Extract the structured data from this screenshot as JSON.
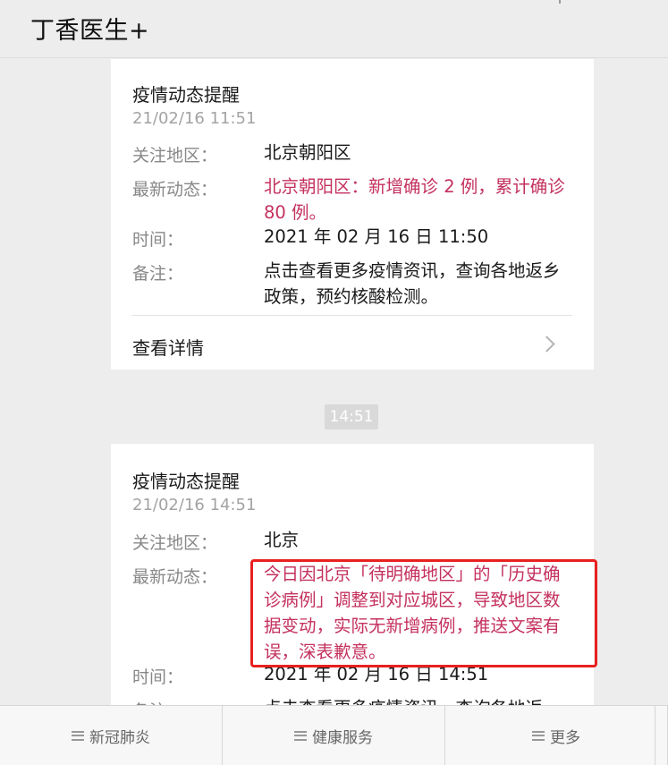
{
  "header": {
    "title": "丁香医生+"
  },
  "messages": [
    {
      "heading": "疫情动态提醒",
      "stamp": "21/02/16 11:51",
      "rows": [
        {
          "label": "关注地区：",
          "value": "北京朝阳区"
        },
        {
          "label": "最新动态：",
          "value": "北京朝阳区：新增确诊 2 例，累计确诊 80 例。"
        },
        {
          "label": "时间：",
          "value": "2021 年 02 月 16 日 11:50"
        },
        {
          "label": "备注：",
          "value": "点击查看更多疫情资讯，查询各地返乡政策，预约核酸检测。"
        }
      ],
      "detail_label": "查看详情"
    },
    {
      "heading": "疫情动态提醒",
      "stamp": "21/02/16 14:51",
      "rows": [
        {
          "label": "关注地区：",
          "value": "北京"
        },
        {
          "label": "最新动态：",
          "value": "今日因北京「待明确地区」的「历史确诊病例」调整到对应城区，导致地区数据变动，实际无新增病例，推送文案有误，深表歉意。"
        },
        {
          "label": "时间：",
          "value": "2021 年 02 月 16 日 14:51"
        },
        {
          "label": "备注：",
          "value": "点击查看更多疫情资讯，查询各地返"
        }
      ]
    }
  ],
  "time_separator": "14:51",
  "tabbar": {
    "items": [
      {
        "label": "新冠肺炎",
        "icon": "menu-icon"
      },
      {
        "label": "健康服务",
        "icon": "menu-icon"
      },
      {
        "label": "更多",
        "icon": "menu-icon"
      }
    ]
  },
  "colors": {
    "accent_red_text": "#c4315e",
    "highlight_box": "#e8201f",
    "background": "#ededed"
  }
}
